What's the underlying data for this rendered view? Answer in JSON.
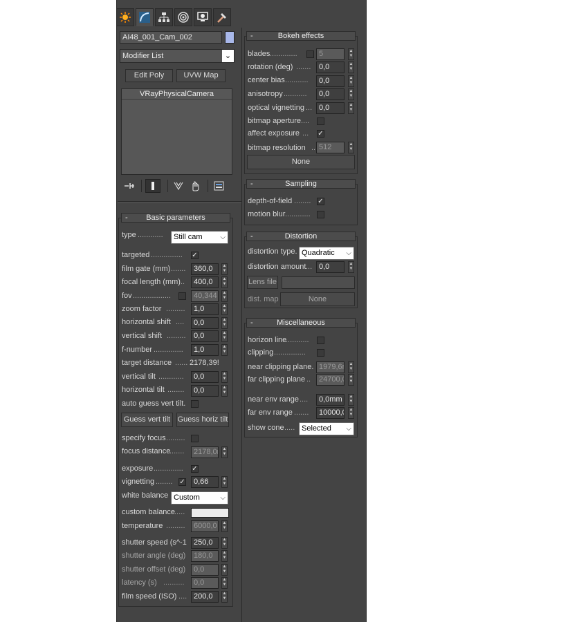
{
  "tabs": [
    {
      "name": "create-tab",
      "icon": "sun-icon"
    },
    {
      "name": "modify-tab",
      "icon": "curve-icon"
    },
    {
      "name": "hierarchy-tab",
      "icon": "hierarchy-icon"
    },
    {
      "name": "motion-tab",
      "icon": "motion-icon"
    },
    {
      "name": "display-tab",
      "icon": "monitor-icon"
    },
    {
      "name": "utilities-tab",
      "icon": "hammer-icon"
    }
  ],
  "object": {
    "name": "AI48_001_Cam_002",
    "color": "#a9b8ea"
  },
  "modifier_list": {
    "label": "Modifier List"
  },
  "quick_buttons": {
    "edit_poly": "Edit Poly",
    "uvw_map": "UVW Map"
  },
  "stack": {
    "items": [
      "VRayPhysicalCamera"
    ]
  },
  "basic": {
    "title": "Basic parameters",
    "type_label": "type",
    "type_value": "Still cam",
    "targeted_label": "targeted",
    "film_gate_label": "film gate (mm)",
    "film_gate_value": "360,0",
    "focal_length_label": "focal length (mm)",
    "focal_length_value": "400,0",
    "fov_label": "fov",
    "fov_value": "40,344",
    "zoom_label": "zoom factor",
    "zoom_value": "1,0",
    "hshift_label": "horizontal shift",
    "hshift_value": "0,0",
    "vshift_label": "vertical shift",
    "vshift_value": "0,0",
    "fnumber_label": "f-number",
    "fnumber_value": "1,0",
    "target_dist_label": "target distance",
    "target_dist_value": "2178,39!",
    "vtilt_label": "vertical tilt",
    "vtilt_value": "0,0",
    "htilt_label": "horizontal tilt",
    "htilt_value": "0,0",
    "auto_guess_label": "auto guess vert tilt.",
    "guess_vert": "Guess vert tilt",
    "guess_horiz": "Guess horiz tilt",
    "specify_focus_label": "specify focus",
    "focus_dist_label": "focus distance",
    "focus_dist_value": "2178,0r",
    "exposure_label": "exposure",
    "vignetting_label": "vignetting",
    "vignetting_value": "0,66",
    "wb_label": "white balance",
    "wb_value": "Custom",
    "custom_balance_label": "custom balance",
    "custom_balance_color": "#ececec",
    "temperature_label": "temperature",
    "temperature_value": "6000,0",
    "shutter_speed_label": "shutter speed (s^-1",
    "shutter_speed_value": "250,0",
    "shutter_angle_label": "shutter angle (deg)",
    "shutter_angle_value": "180,0",
    "shutter_offset_label": "shutter offset (deg)",
    "shutter_offset_value": "0,0",
    "latency_label": "latency (s)",
    "latency_value": "0,0",
    "film_speed_label": "film speed (ISO)",
    "film_speed_value": "200,0"
  },
  "bokeh": {
    "title": "Bokeh effects",
    "blades_label": "blades",
    "blades_value": "5",
    "rotation_label": "rotation (deg)",
    "rotation_value": "0,0",
    "center_bias_label": "center bias",
    "center_bias_value": "0,0",
    "anisotropy_label": "anisotropy",
    "anisotropy_value": "0,0",
    "optical_vig_label": "optical vignetting",
    "optical_vig_value": "0,0",
    "bitmap_aperture_label": "bitmap aperture",
    "affect_exposure_label": "affect exposure",
    "bitmap_res_label": "bitmap resolution",
    "bitmap_res_value": "512",
    "none_button": "None"
  },
  "sampling": {
    "title": "Sampling",
    "dof_label": "depth-of-field",
    "motion_blur_label": "motion blur"
  },
  "distortion": {
    "title": "Distortion",
    "type_label": "distortion type.",
    "type_value": "Quadratic",
    "amount_label": "distortion amount",
    "amount_value": "0,0",
    "lens_file_button": "Lens file",
    "dist_map_label": "dist. map",
    "dist_map_button": "None"
  },
  "misc": {
    "title": "Miscellaneous",
    "horizon_label": "horizon line",
    "clipping_label": "clipping",
    "near_clip_label": "near clipping plane.",
    "near_clip_value": "1979,6r",
    "far_clip_label": "far clipping plane",
    "far_clip_value": "24700,0",
    "near_env_label": "near env range",
    "near_env_value": "0,0mm",
    "far_env_label": "far env range",
    "far_env_value": "10000,0",
    "show_cone_label": "show cone",
    "show_cone_value": "Selected"
  }
}
